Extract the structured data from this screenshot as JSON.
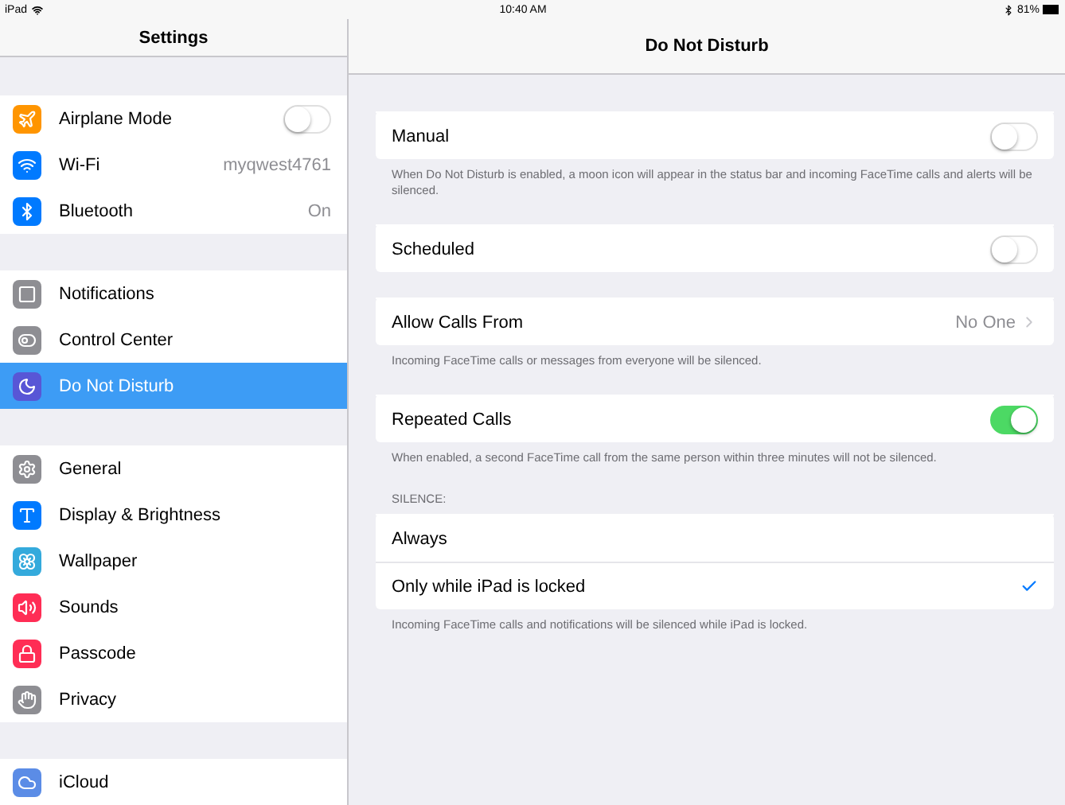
{
  "status_bar": {
    "carrier": "iPad",
    "time": "10:40 AM",
    "battery": "81%"
  },
  "sidebar": {
    "title": "Settings",
    "groups": [
      [
        {
          "label": "Airplane Mode",
          "color": "#ff9500",
          "kind": "toggle",
          "on": false,
          "selected": false
        },
        {
          "label": "Wi-Fi",
          "color": "#007aff",
          "kind": "value",
          "value": "myqwest4761",
          "selected": false
        },
        {
          "label": "Bluetooth",
          "color": "#007aff",
          "kind": "value",
          "value": "On",
          "selected": false
        }
      ],
      [
        {
          "label": "Notifications",
          "color": "#8e8e93",
          "kind": "plain",
          "selected": false
        },
        {
          "label": "Control Center",
          "color": "#8e8e93",
          "kind": "plain",
          "selected": false
        },
        {
          "label": "Do Not Disturb",
          "color": "#5856d6",
          "kind": "plain",
          "selected": true
        }
      ],
      [
        {
          "label": "General",
          "color": "#8e8e93",
          "kind": "plain",
          "selected": false
        },
        {
          "label": "Display & Brightness",
          "color": "#007aff",
          "kind": "plain",
          "selected": false
        },
        {
          "label": "Wallpaper",
          "color": "#34aadc",
          "kind": "plain",
          "selected": false
        },
        {
          "label": "Sounds",
          "color": "#ff2d55",
          "kind": "plain",
          "selected": false
        },
        {
          "label": "Passcode",
          "color": "#ff2d55",
          "kind": "plain",
          "selected": false
        },
        {
          "label": "Privacy",
          "color": "#8e8e93",
          "kind": "plain",
          "selected": false
        }
      ],
      [
        {
          "label": "iCloud",
          "color": "#5b8ce6",
          "kind": "plain",
          "selected": false
        }
      ]
    ]
  },
  "detail": {
    "title": "Do Not Disturb",
    "sections": [
      {
        "rows": [
          {
            "label": "Manual",
            "kind": "toggle",
            "on": false
          }
        ],
        "footer": "When Do Not Disturb is enabled, a moon icon will appear in the status bar and incoming FaceTime calls and alerts will be silenced."
      },
      {
        "rows": [
          {
            "label": "Scheduled",
            "kind": "toggle",
            "on": false
          }
        ]
      },
      {
        "rows": [
          {
            "label": "Allow Calls From",
            "kind": "disclosure",
            "value": "No One"
          }
        ],
        "footer": "Incoming FaceTime calls or messages from everyone will be silenced."
      },
      {
        "rows": [
          {
            "label": "Repeated Calls",
            "kind": "toggle",
            "on": true
          }
        ],
        "footer": "When enabled, a second FaceTime call from the same person within three minutes will not be silenced."
      },
      {
        "header": "SILENCE:",
        "rows": [
          {
            "label": "Always",
            "kind": "check",
            "selected": false
          },
          {
            "label": "Only while iPad is locked",
            "kind": "check",
            "selected": true
          }
        ],
        "footer": "Incoming FaceTime calls and notifications will be silenced while iPad is locked."
      }
    ]
  }
}
